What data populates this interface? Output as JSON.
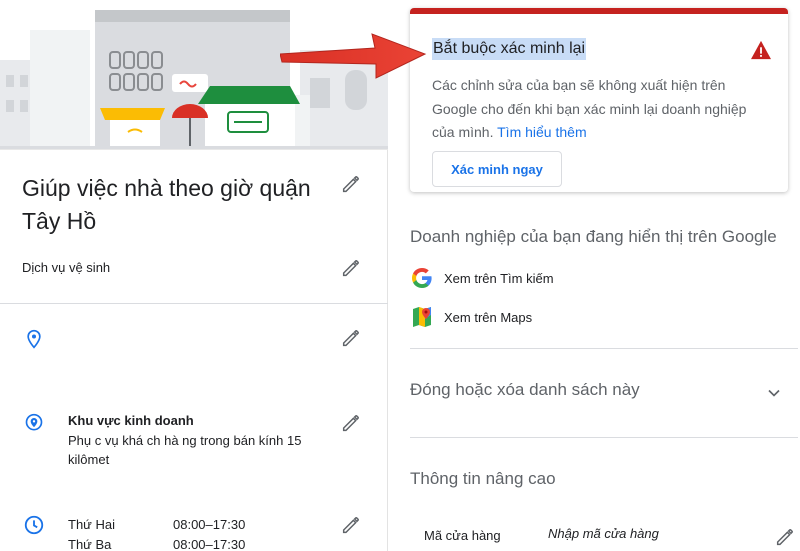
{
  "business": {
    "name": "Giúp việc nhà theo giờ quận Tây Hồ",
    "category": "Dịch vụ vệ sinh"
  },
  "service_area": {
    "title": "Khu vực kinh doanh",
    "description": "Phụ c vụ khá ch hà ng trong bán kính 15 kilômet"
  },
  "hours": [
    {
      "day": "Thứ Hai",
      "time": "08:00–17:30"
    },
    {
      "day": "Thứ Ba",
      "time": "08:00–17:30"
    }
  ],
  "verify_card": {
    "title": "Bắt buộc xác minh lại",
    "body": "Các chỉnh sửa của bạn sẽ không xuất hiện trên Google cho đến khi bạn xác minh lại doanh nghiệp của mình.",
    "learn_more": "Tìm hiểu thêm",
    "button": "Xác minh ngay",
    "accent_color": "#c5221f"
  },
  "shown_on_google": {
    "title": "Doanh nghiệp của bạn đang hiển thị trên Google",
    "search_link": "Xem trên Tìm kiếm",
    "maps_link": "Xem trên Maps"
  },
  "close_section": {
    "title": "Đóng hoặc xóa danh sách này"
  },
  "advanced": {
    "title": "Thông tin nâng cao",
    "store_code_label": "Mã cửa hàng",
    "store_code_placeholder": "Nhập mã cửa hàng"
  },
  "icons": {
    "edit": "pencil-icon",
    "location": "location-pin-icon",
    "service_area": "service-area-icon",
    "hours": "clock-icon",
    "warning": "warning-icon",
    "search": "google-g-icon",
    "maps": "google-maps-icon",
    "expand": "chevron-down-icon"
  }
}
